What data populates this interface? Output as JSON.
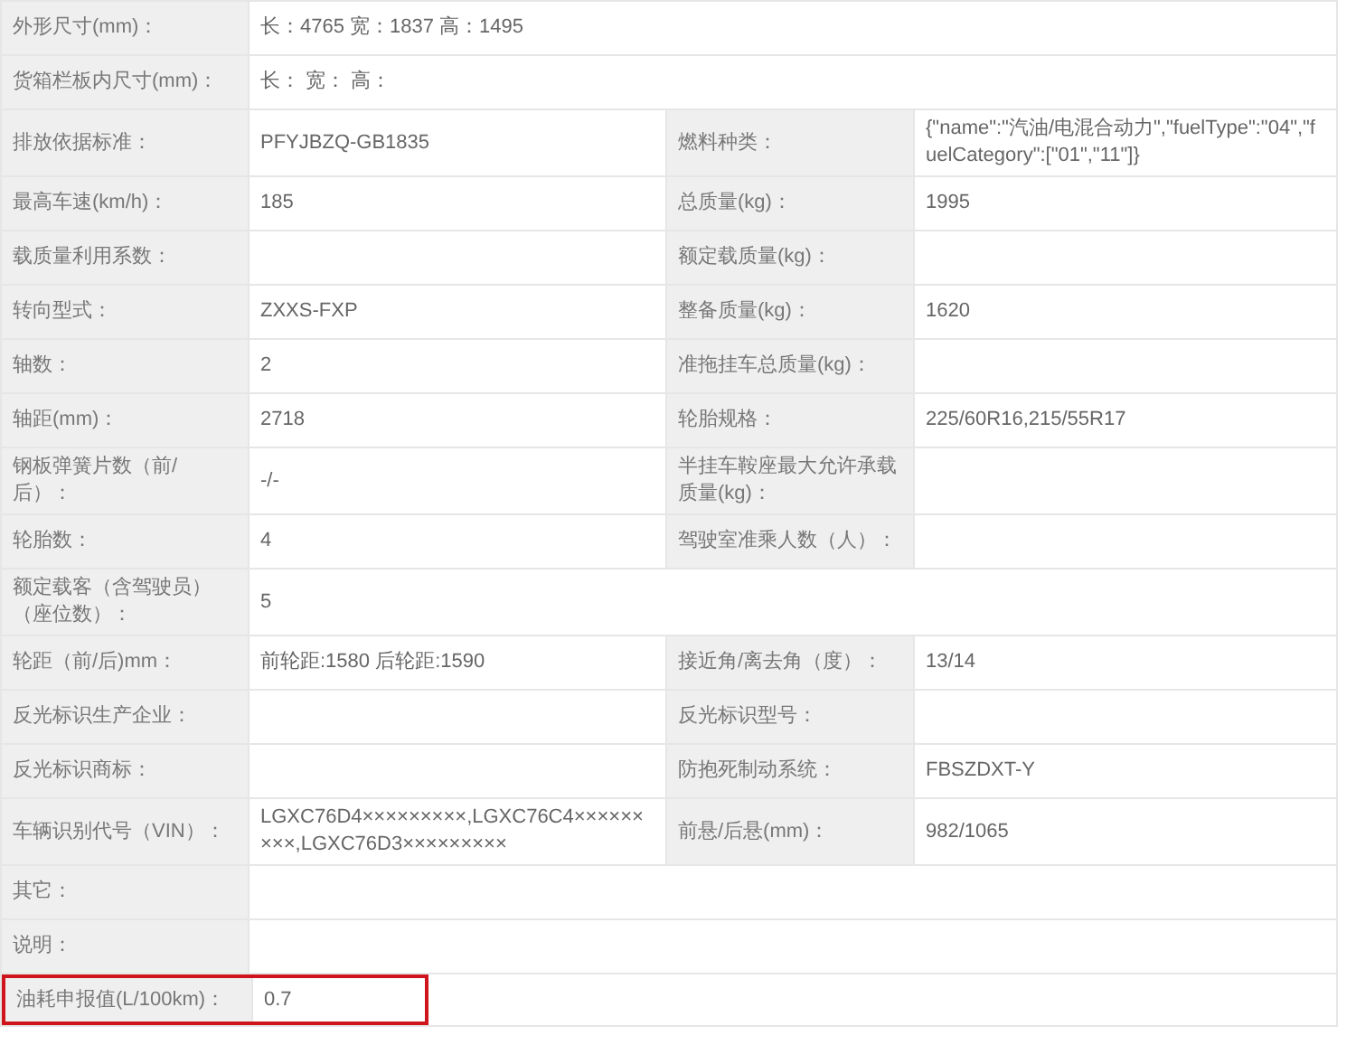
{
  "rows": [
    {
      "highlighted": false,
      "pairs": [
        {
          "label": "外形尺寸(mm)：",
          "value": "长：4765 宽：1837 高：1495"
        }
      ]
    },
    {
      "highlighted": false,
      "pairs": [
        {
          "label": "货箱栏板内尺寸(mm)：",
          "value": "长： 宽： 高："
        }
      ]
    },
    {
      "highlighted": false,
      "pairs": [
        {
          "label": "排放依据标准：",
          "value": "PFYJBZQ-GB1835"
        },
        {
          "label": "燃料种类：",
          "value": "{\"name\":\"汽油/电混合动力\",\"fuelType\":\"04\",\"fuelCategory\":[\"01\",\"11\"]}"
        }
      ]
    },
    {
      "highlighted": false,
      "pairs": [
        {
          "label": "最高车速(km/h)：",
          "value": "185"
        },
        {
          "label": "总质量(kg)：",
          "value": "1995"
        }
      ]
    },
    {
      "highlighted": false,
      "pairs": [
        {
          "label": "载质量利用系数："
        },
        {
          "label": "额定载质量(kg)："
        }
      ]
    },
    {
      "highlighted": false,
      "pairs": [
        {
          "label": "转向型式：",
          "value": "ZXXS-FXP"
        },
        {
          "label": "整备质量(kg)：",
          "value": "1620"
        }
      ]
    },
    {
      "highlighted": false,
      "pairs": [
        {
          "label": "轴数：",
          "value": "2"
        },
        {
          "label": "准拖挂车总质量(kg)："
        }
      ]
    },
    {
      "highlighted": false,
      "pairs": [
        {
          "label": "轴距(mm)：",
          "value": "2718"
        },
        {
          "label": "轮胎规格：",
          "value": "225/60R16,215/55R17"
        }
      ]
    },
    {
      "highlighted": false,
      "pairs": [
        {
          "label": "钢板弹簧片数（前/后）：",
          "value": "-/-"
        },
        {
          "label": "半挂车鞍座最大允许承载质量(kg)："
        }
      ]
    },
    {
      "highlighted": false,
      "pairs": [
        {
          "label": "轮胎数：",
          "value": "4"
        },
        {
          "label": "驾驶室准乘人数（人）："
        }
      ]
    },
    {
      "highlighted": false,
      "pairs": [
        {
          "label": "额定载客（含驾驶员）（座位数）：",
          "value": "5"
        }
      ]
    },
    {
      "highlighted": false,
      "pairs": [
        {
          "label": "轮距（前/后)mm：",
          "value": "前轮距:1580 后轮距:1590"
        },
        {
          "label": "接近角/离去角（度）：",
          "value": "13/14"
        }
      ]
    },
    {
      "highlighted": false,
      "pairs": [
        {
          "label": "反光标识生产企业："
        },
        {
          "label": "反光标识型号："
        }
      ]
    },
    {
      "highlighted": false,
      "pairs": [
        {
          "label": "反光标识商标："
        },
        {
          "label": "防抱死制动系统：",
          "value": "FBSZDXT-Y"
        }
      ]
    },
    {
      "highlighted": false,
      "pairs": [
        {
          "label": "车辆识别代号（VIN）：",
          "value": "LGXC76D4×××××××××,LGXC76C4×××××××××,LGXC76D3×××××××××"
        },
        {
          "label": "前悬/后悬(mm)：",
          "value": "982/1065"
        }
      ]
    },
    {
      "highlighted": false,
      "pairs": [
        {
          "label": "其它："
        }
      ]
    },
    {
      "highlighted": false,
      "pairs": [
        {
          "label": "说明："
        }
      ]
    },
    {
      "highlighted": true,
      "pairs": [
        {
          "label": "油耗申报值(L/100km)：",
          "value": "0.7"
        }
      ]
    }
  ]
}
